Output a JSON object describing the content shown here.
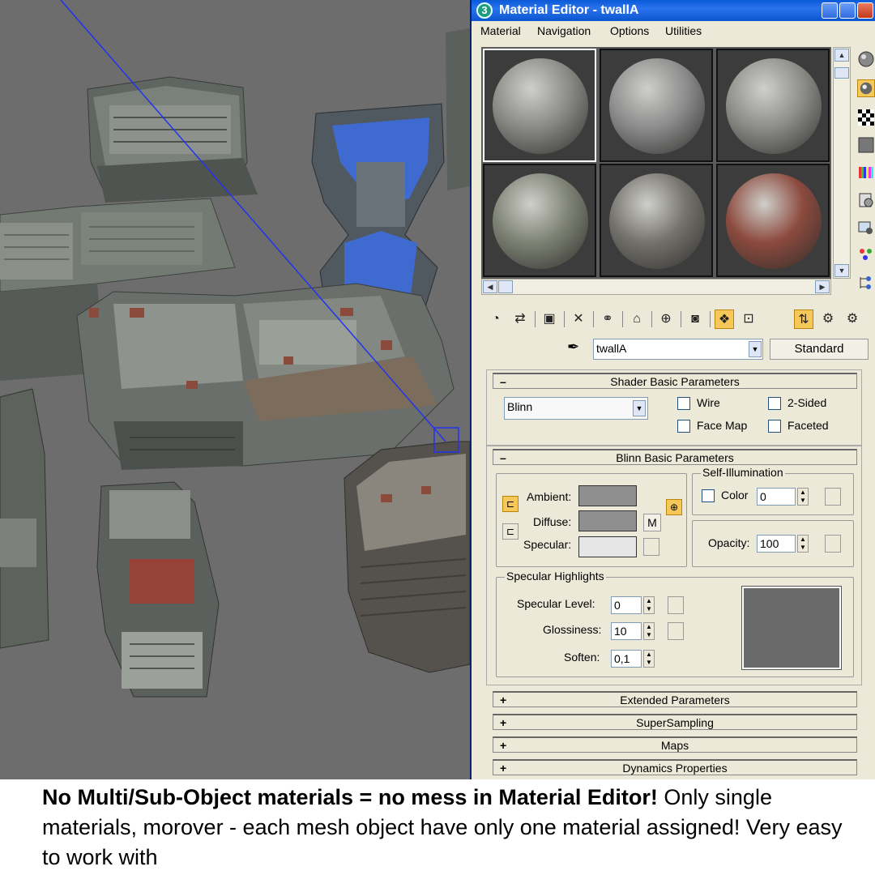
{
  "window": {
    "title": "Material Editor - twallA",
    "app_icon": "3ds-max-icon"
  },
  "menu": [
    "Material",
    "Navigation",
    "Options",
    "Utilities"
  ],
  "sample_slots": [
    {
      "id": 1,
      "color": "#8a8a86",
      "active": true
    },
    {
      "id": 2,
      "color": "#8c8d8c",
      "active": false
    },
    {
      "id": 3,
      "color": "#8d8d89",
      "active": false
    },
    {
      "id": 4,
      "color": "#7e8274",
      "active": false
    },
    {
      "id": 5,
      "color": "#74726c",
      "active": false
    },
    {
      "id": 6,
      "color": "#8c4a3e",
      "active": false
    }
  ],
  "side_toolbar_icons": [
    "sample-type-icon",
    "backlight-icon",
    "background-icon",
    "uv-tiling-icon",
    "video-color-check-icon",
    "make-preview-icon",
    "options-icon",
    "select-by-material-icon",
    "material-map-navigator-icon"
  ],
  "bottom_toolbar_icons": [
    "get-material-icon",
    "put-to-scene-icon",
    "assign-material-icon",
    "reset-map-icon",
    "make-unique-icon",
    "put-to-library-icon",
    "material-id-channel-icon",
    "show-map-in-viewport-icon",
    "show-end-result-icon",
    "go-to-parent-icon",
    "go-forward-to-sibling-icon"
  ],
  "name_row": {
    "material_name": "twallA",
    "type_button": "Standard"
  },
  "shader_basic": {
    "header": "Shader Basic Parameters",
    "shader": "Blinn",
    "wire": "Wire",
    "two_sided": "2-Sided",
    "face_map": "Face Map",
    "faceted": "Faceted"
  },
  "blinn_basic": {
    "header": "Blinn Basic Parameters",
    "ambient_label": "Ambient:",
    "diffuse_label": "Diffuse:",
    "specular_label": "Specular:",
    "map_button": "M",
    "self_illum": {
      "title": "Self-Illumination",
      "color_label": "Color",
      "value": "0"
    },
    "opacity_label": "Opacity:",
    "opacity_value": "100",
    "colors": {
      "ambient": "#8f8f8f",
      "diffuse": "#8f8f8f",
      "specular": "#e6e6e6"
    }
  },
  "specular_highlights": {
    "title": "Specular Highlights",
    "level_label": "Specular Level:",
    "level_value": "0",
    "gloss_label": "Glossiness:",
    "gloss_value": "10",
    "soften_label": "Soften:",
    "soften_value": "0,1"
  },
  "collapsed_rollouts": [
    "Extended Parameters",
    "SuperSampling",
    "Maps",
    "Dynamics Properties"
  ],
  "caption": {
    "bold": "No Multi/Sub-Object materials = no mess in Material Editor!",
    "rest": " Only single materials, morover - each mesh object have only one material assigned! Very easy to work with"
  }
}
